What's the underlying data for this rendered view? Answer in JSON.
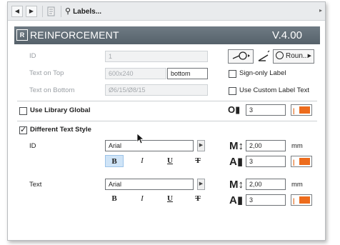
{
  "toolbar": {
    "title": "Labels..."
  },
  "header": {
    "logo": "R",
    "title": "REINFORCEMENT",
    "version": "V.4.00"
  },
  "top": {
    "id_label": "ID",
    "id_value": "1",
    "text_top_label": "Text on Top",
    "text_top_value": "600x240",
    "text_top_position": "bottom",
    "text_bottom_label": "Text on Bottom",
    "text_bottom_value": "Ø6/15/Ø8/15",
    "shape_button": "Roun...",
    "sign_only_label": "Sign-only Label",
    "custom_label_text": "Use Custom Label Text"
  },
  "library": {
    "label": "Use Library Global",
    "pen_value": "3"
  },
  "text_style": {
    "label": "Different Text Style",
    "id_section": {
      "label": "ID",
      "font": "Arial",
      "size": "2,00",
      "unit": "mm",
      "pen": "3"
    },
    "text_section": {
      "label": "Text",
      "font": "Arial",
      "size": "2,00",
      "unit": "mm",
      "pen": "3"
    },
    "styles": {
      "bold": "B",
      "italic": "I",
      "underline": "U",
      "strike": "T"
    }
  },
  "colors": {
    "accent_orange": "#ED6C1D",
    "header_bg": "#5F6A73",
    "selected_blue": "#CFE4F7"
  }
}
